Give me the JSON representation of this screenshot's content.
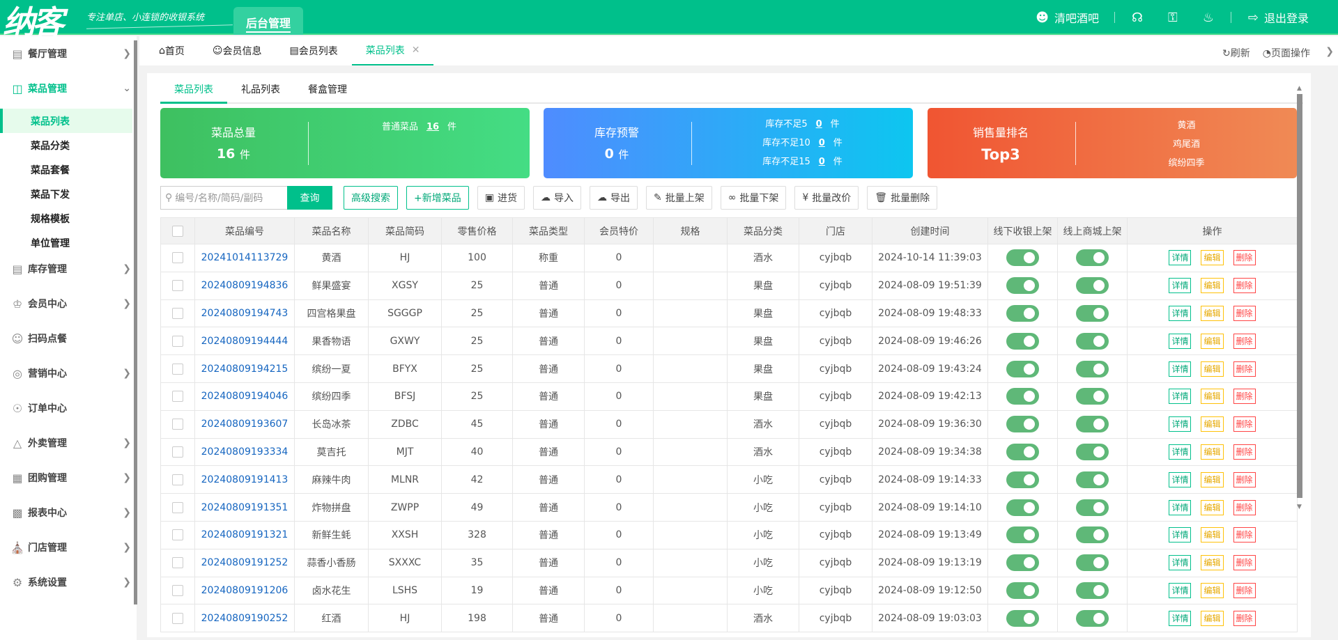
{
  "header": {
    "logo": "纳客",
    "slogan": "专注单店、小连锁的收银系统",
    "module_tab": "后台管理",
    "user": "清吧酒吧",
    "logout": "退出登录"
  },
  "sidebar": {
    "items": [
      {
        "label": "餐厅管理",
        "icon": "building-icon",
        "chevron": true
      },
      {
        "label": "菜品管理",
        "icon": "layout-icon",
        "chevron": true,
        "open": true,
        "children": [
          "菜品列表",
          "菜品分类",
          "菜品套餐",
          "菜品下发",
          "规格模板",
          "单位管理"
        ]
      },
      {
        "label": "库存管理",
        "icon": "box-icon",
        "chevron": true
      },
      {
        "label": "会员中心",
        "icon": "crown-icon",
        "chevron": true
      },
      {
        "label": "扫码点餐",
        "icon": "user-icon",
        "chevron": false
      },
      {
        "label": "营销中心",
        "icon": "target-icon",
        "chevron": true
      },
      {
        "label": "订单中心",
        "icon": "globe-icon",
        "chevron": false
      },
      {
        "label": "外卖管理",
        "icon": "bell-service-icon",
        "chevron": true
      },
      {
        "label": "团购管理",
        "icon": "calendar-icon",
        "chevron": true
      },
      {
        "label": "报表中心",
        "icon": "bar-chart-icon",
        "chevron": true
      },
      {
        "label": "门店管理",
        "icon": "store-icon",
        "chevron": true
      },
      {
        "label": "系统设置",
        "icon": "gear-icon",
        "chevron": true
      }
    ]
  },
  "tabs": [
    {
      "label": "首页"
    },
    {
      "label": "会员信息"
    },
    {
      "label": "会员列表"
    },
    {
      "label": "菜品列表",
      "active": true
    }
  ],
  "tab_actions": {
    "refresh": "刷新",
    "page_ops": "页面操作"
  },
  "inner_tabs": [
    "菜品列表",
    "礼品列表",
    "餐盒管理"
  ],
  "stats": {
    "total": {
      "title": "菜品总量",
      "value": "16",
      "unit": "件",
      "normal_label": "普通菜品",
      "normal_value": "16"
    },
    "stock": {
      "title": "库存预警",
      "value": "0",
      "unit": "件",
      "rows": [
        {
          "label": "库存不足5",
          "value": "0"
        },
        {
          "label": "库存不足10",
          "value": "0"
        },
        {
          "label": "库存不足15",
          "value": "0"
        }
      ]
    },
    "sales": {
      "title": "销售量排名",
      "value": "Top3",
      "top": [
        "黄酒",
        "鸡尾酒",
        "缤纷四季"
      ]
    }
  },
  "toolbar": {
    "search_placeholder": "编号/名称/简码/副码",
    "query": "查询",
    "advanced": "高级搜索",
    "add": "+新增菜品",
    "buttons": [
      "进货",
      "导入",
      "导出",
      "批量上架",
      "批量下架",
      "批量改价",
      "批量删除"
    ]
  },
  "table": {
    "headers": [
      "菜品编号",
      "菜品名称",
      "菜品简码",
      "零售价格",
      "菜品类型",
      "会员特价",
      "规格",
      "菜品分类",
      "门店",
      "创建时间",
      "线下收银上架",
      "线上商城上架",
      "操作"
    ],
    "actions": [
      "详情",
      "编辑",
      "删除"
    ],
    "rows": [
      [
        "20241014113729",
        "黄酒",
        "HJ",
        "100",
        "称重",
        "0",
        "",
        "酒水",
        "cyjbqb",
        "2024-10-14 11:39:03"
      ],
      [
        "20240809194836",
        "鲜果盛宴",
        "XGSY",
        "25",
        "普通",
        "0",
        "",
        "果盘",
        "cyjbqb",
        "2024-08-09 19:51:39"
      ],
      [
        "20240809194743",
        "四宫格果盘",
        "SGGGP",
        "25",
        "普通",
        "0",
        "",
        "果盘",
        "cyjbqb",
        "2024-08-09 19:48:33"
      ],
      [
        "20240809194444",
        "果香物语",
        "GXWY",
        "25",
        "普通",
        "0",
        "",
        "果盘",
        "cyjbqb",
        "2024-08-09 19:46:26"
      ],
      [
        "20240809194215",
        "缤纷一夏",
        "BFYX",
        "25",
        "普通",
        "0",
        "",
        "果盘",
        "cyjbqb",
        "2024-08-09 19:43:24"
      ],
      [
        "20240809194046",
        "缤纷四季",
        "BFSJ",
        "25",
        "普通",
        "0",
        "",
        "果盘",
        "cyjbqb",
        "2024-08-09 19:42:13"
      ],
      [
        "20240809193607",
        "长岛冰茶",
        "ZDBC",
        "45",
        "普通",
        "0",
        "",
        "酒水",
        "cyjbqb",
        "2024-08-09 19:36:30"
      ],
      [
        "20240809193334",
        "莫吉托",
        "MJT",
        "40",
        "普通",
        "0",
        "",
        "酒水",
        "cyjbqb",
        "2024-08-09 19:34:38"
      ],
      [
        "20240809191413",
        "麻辣牛肉",
        "MLNR",
        "42",
        "普通",
        "0",
        "",
        "小吃",
        "cyjbqb",
        "2024-08-09 19:14:33"
      ],
      [
        "20240809191351",
        "炸物拼盘",
        "ZWPP",
        "49",
        "普通",
        "0",
        "",
        "小吃",
        "cyjbqb",
        "2024-08-09 19:14:10"
      ],
      [
        "20240809191321",
        "新鲜生蚝",
        "XXSH",
        "328",
        "普通",
        "0",
        "",
        "小吃",
        "cyjbqb",
        "2024-08-09 19:13:49"
      ],
      [
        "20240809191252",
        "蒜香小香肠",
        "SXXXC",
        "35",
        "普通",
        "0",
        "",
        "小吃",
        "cyjbqb",
        "2024-08-09 19:13:19"
      ],
      [
        "20240809191206",
        "卤水花生",
        "LSHS",
        "19",
        "普通",
        "0",
        "",
        "小吃",
        "cyjbqb",
        "2024-08-09 19:12:50"
      ],
      [
        "20240809190252",
        "红酒",
        "HJ",
        "198",
        "普通",
        "0",
        "",
        "酒水",
        "cyjbqb",
        "2024-08-09 19:03:03"
      ]
    ]
  },
  "colors": {
    "brand": "#00c08b",
    "green_card": "#3ec060",
    "blue_card": "#4f8cff",
    "orange_card": "#f05532"
  }
}
